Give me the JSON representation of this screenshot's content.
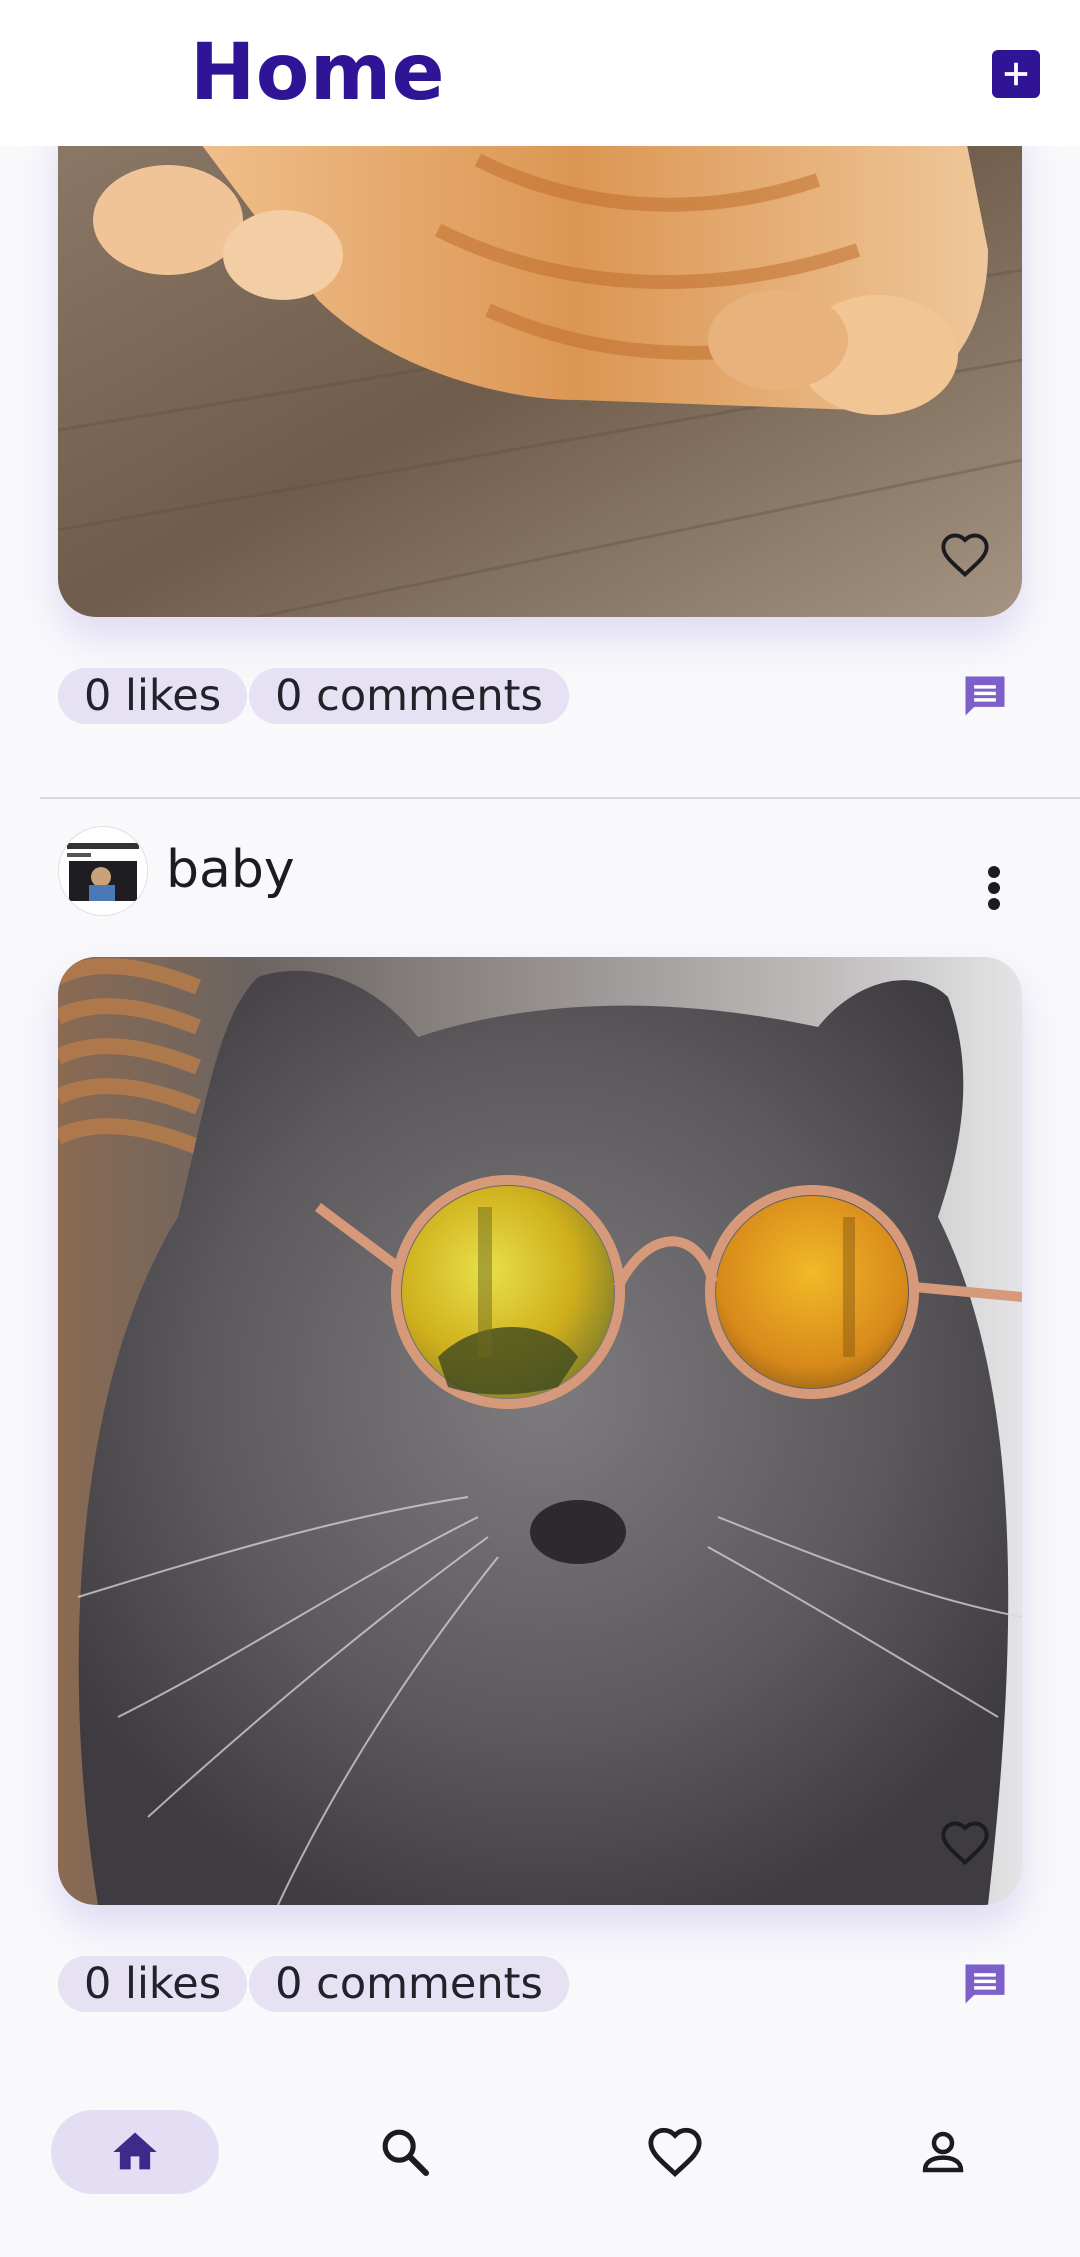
{
  "app_bar": {
    "title": "Home",
    "add_icon": "add-box-icon"
  },
  "colors": {
    "primary": "#2f1496",
    "chip_background": "#e6e1f3",
    "comment_icon": "#7c5fc9",
    "nav_active_background": "#e4def5",
    "nav_active_icon": "#3f2a8c"
  },
  "posts": [
    {
      "image": "orange tabby cat lying on wooden floor",
      "likes": "0 likes",
      "comments": "0 comments",
      "like_icon": "heart-outline-icon",
      "comment_icon": "comment-icon"
    },
    {
      "username": "baby",
      "avatar": "user avatar thumbnail",
      "menu_icon": "more-vertical-icon",
      "image": "grey cat wearing round yellow sunglasses",
      "likes": "0 likes",
      "comments": "0 comments",
      "like_icon": "heart-outline-icon",
      "comment_icon": "comment-icon"
    }
  ],
  "bottom_nav": {
    "items": [
      {
        "name": "home",
        "icon": "home-icon",
        "active": true
      },
      {
        "name": "search",
        "icon": "search-icon",
        "active": false
      },
      {
        "name": "favorites",
        "icon": "heart-outline-icon",
        "active": false
      },
      {
        "name": "profile",
        "icon": "person-icon",
        "active": false
      }
    ]
  }
}
